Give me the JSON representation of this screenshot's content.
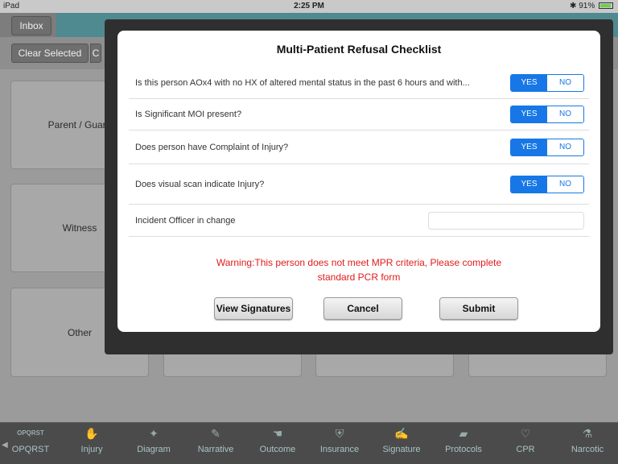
{
  "status_bar": {
    "device": "iPad",
    "time": "2:25 PM",
    "battery": "91%"
  },
  "background": {
    "inbox_label": "Inbox",
    "clear_selected_label": "Clear Selected",
    "clear_selected_extra": "C",
    "cards": [
      "Parent / Guard",
      "Witness",
      "Other"
    ]
  },
  "dialog": {
    "title": "Multi-Patient Refusal Checklist",
    "questions": [
      {
        "label": "Is this person AOx4 with no HX of altered mental status in the past 6 hours and with...",
        "yes": "YES",
        "no": "NO",
        "selected": "YES"
      },
      {
        "label": "Is Significant MOI present?",
        "yes": "YES",
        "no": "NO",
        "selected": "YES"
      },
      {
        "label": "Does person have Complaint of Injury?",
        "yes": "YES",
        "no": "NO",
        "selected": "YES"
      },
      {
        "label": "Does visual scan indicate Injury?",
        "yes": "YES",
        "no": "NO",
        "selected": "YES"
      }
    ],
    "officer": {
      "label": "Incident Officer in change",
      "value": ""
    },
    "warning_line1": "Warning:This person does not meet MPR criteria, Please complete",
    "warning_line2": "standard PCR form",
    "buttons": {
      "view_signatures": "View Signatures",
      "cancel": "Cancel",
      "submit": "Submit"
    }
  },
  "tabbar": {
    "tabs": [
      {
        "label": "OPQRST",
        "icon": "opqrst-icon"
      },
      {
        "label": "Injury",
        "icon": "hand-icon"
      },
      {
        "label": "Diagram",
        "icon": "body-icon"
      },
      {
        "label": "Narrative",
        "icon": "narrative-icon"
      },
      {
        "label": "Outcome",
        "icon": "outcome-icon"
      },
      {
        "label": "Insurance",
        "icon": "shield-icon"
      },
      {
        "label": "Signature",
        "icon": "signature-icon"
      },
      {
        "label": "Protocols",
        "icon": "folder-icon"
      },
      {
        "label": "CPR",
        "icon": "heart-icon"
      },
      {
        "label": "Narcotic",
        "icon": "narcotic-icon"
      }
    ]
  }
}
